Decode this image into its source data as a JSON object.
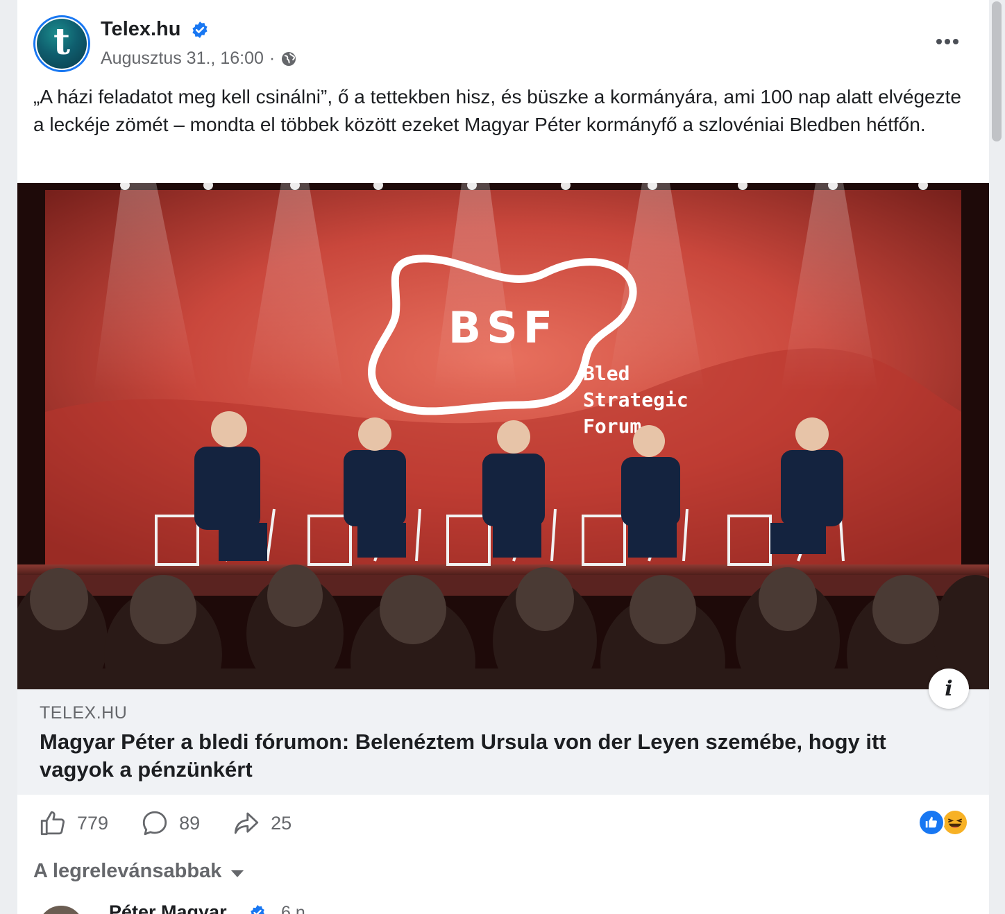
{
  "post": {
    "page_name": "Telex.hu",
    "timestamp": "Augusztus 31., 16:00",
    "separator": "·",
    "avatar_letter": "t",
    "text": "„A házi feladatot meg kell csinálni”, ő a tettekben hisz, és büszke a kormányára, ami 100 nap alatt elvégezte a leckéje zömét – mondta el többek között ezeket Magyar Péter kormányfő a szlovéniai Bledben hétfőn."
  },
  "image": {
    "logo_text": "BSF",
    "forum_line1": "Bled",
    "forum_line2": "Strategic",
    "forum_line3": "Forum"
  },
  "link": {
    "domain": "TELEX.HU",
    "title": "Magyar Péter a bledi fórumon: Belenéztem Ursula von der Leyen szemébe, hogy itt vagyok a pénzünkért",
    "info_icon": "i"
  },
  "actions": {
    "likes": "779",
    "comments": "89",
    "shares": "25"
  },
  "reactions": [
    "like-icon",
    "haha-icon"
  ],
  "comments_section": {
    "sort_label": "A legrelevánsabbak",
    "first_comment_author": "Péter Magyar",
    "first_comment_time": "6 n"
  },
  "colors": {
    "accent": "#1877f2",
    "secondary_text": "#65676b",
    "preview_bg": "#f0f2f5"
  }
}
